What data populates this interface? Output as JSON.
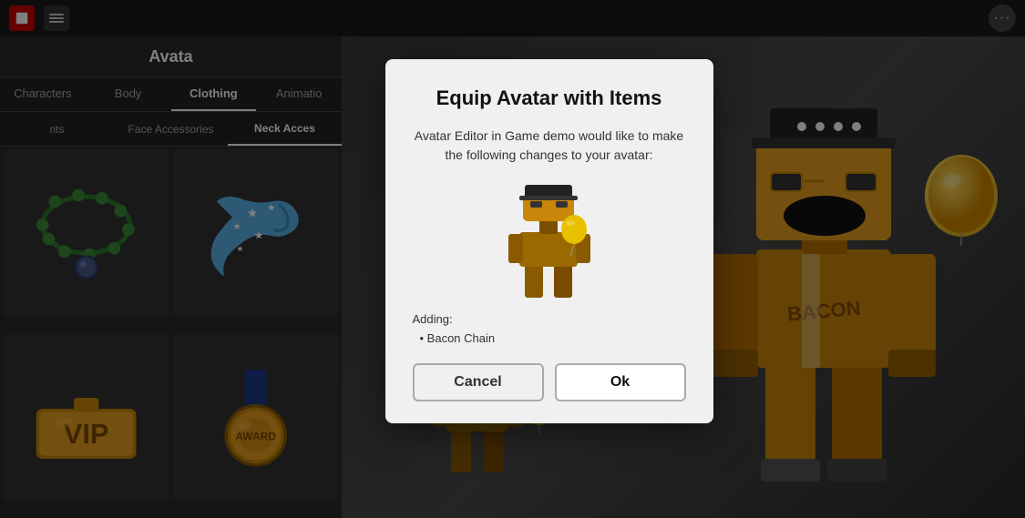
{
  "topbar": {
    "more_button_label": "···"
  },
  "left_panel": {
    "title": "Avata",
    "nav_tabs_1": [
      {
        "label": "Characters",
        "active": false
      },
      {
        "label": "Body",
        "active": false
      },
      {
        "label": "Clothing",
        "active": true
      },
      {
        "label": "Animatio",
        "active": false
      }
    ],
    "nav_tabs_2": [
      {
        "label": "nts",
        "active": false
      },
      {
        "label": "Face Accessories",
        "active": false
      },
      {
        "label": "Neck Acces",
        "active": true
      }
    ]
  },
  "modal": {
    "title": "Equip Avatar with Items",
    "body": "Avatar Editor in Game demo would like to make the following changes to your avatar:",
    "adding_label": "Adding:",
    "item_name": "Bacon Chain",
    "cancel_label": "Cancel",
    "ok_label": "Ok"
  },
  "items": [
    {
      "id": "necklace",
      "type": "necklace"
    },
    {
      "id": "scarf",
      "type": "scarf"
    },
    {
      "id": "vip",
      "type": "vip"
    },
    {
      "id": "medal",
      "type": "medal"
    }
  ]
}
